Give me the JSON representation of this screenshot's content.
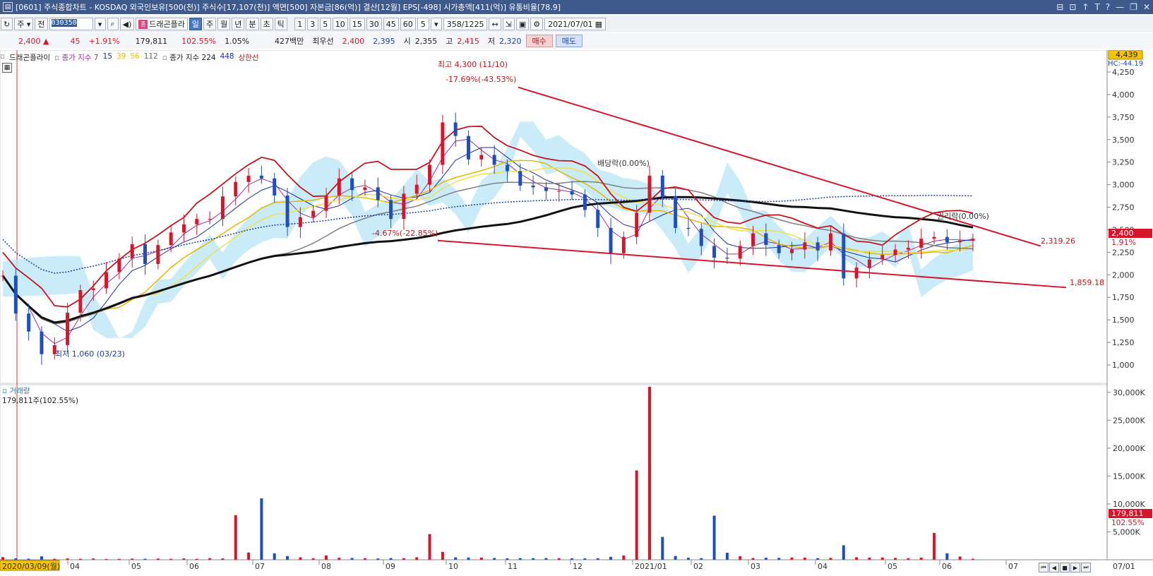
{
  "window": {
    "title": "[0601] 주식종합차트 - KOSDAQ 외국인보유[500(천)] 주식수[17,107(천)] 액면[500] 자본금[86(억)] 결산[12월] EPS[-498] 시가총액[411(억)] 유통비율[78.9]",
    "controls": [
      "⊟",
      "⊡",
      "↑",
      "T",
      "?",
      "—",
      "❐",
      "✕"
    ]
  },
  "toolbar": {
    "market": "주",
    "scope": "전",
    "code": "030350",
    "dragon_label": "드래곤플라",
    "periods": [
      "일",
      "주",
      "월",
      "년",
      "분",
      "초",
      "틱"
    ],
    "active_period": "일",
    "intervals": [
      "1",
      "3",
      "5",
      "10",
      "15",
      "30",
      "45",
      "60"
    ],
    "interval_value": "5",
    "count": "358",
    "total": "/1225",
    "date": "2021/07/01"
  },
  "quote": {
    "price": "2,400",
    "arrow": "▲",
    "change": "45",
    "change_pct": "+1.91%",
    "volume": "179,811",
    "volume_ratio": "102.55%",
    "turnover": "1.05%",
    "amount": "427백만",
    "best_label": "최우선",
    "ask": "2,400",
    "bid": "2,395",
    "open_label": "시",
    "open": "2,355",
    "high_label": "고",
    "high": "2,415",
    "low_label": "저",
    "low": "2,320",
    "buy": "매수",
    "sell": "매도"
  },
  "legend": {
    "dragon": "드래곤플라이",
    "ma_label": "종가 지수 7",
    "ma15": "15",
    "ma39": "39",
    "ma56": "56",
    "ma112": "112",
    "ma_label2": "종가 지수 224",
    "ma448": "448",
    "upper_line": "상한선"
  },
  "chart_data": {
    "type": "candlestick",
    "price_axis": {
      "ticks": [
        "4,250",
        "4,000",
        "3,750",
        "3,500",
        "3,250",
        "3,000",
        "2,750",
        "2,500",
        "2,250",
        "2,000",
        "1,750",
        "1,500",
        "1,250",
        "1,000"
      ],
      "ylim": [
        1000,
        4300
      ],
      "current_price_badge": "4,439",
      "hc_label": "HC:-44.19",
      "last_price": "2,400",
      "last_pct": "1.91%"
    },
    "volume_axis": {
      "ticks": [
        "30,000K",
        "25,000K",
        "20,000K",
        "15,000K",
        "10,000K",
        "5,000K"
      ],
      "last_volume": "179,811",
      "last_volume_pct": "102.55%",
      "title": "거래량",
      "value_line": "179,811주(102.55%)"
    },
    "x_axis": {
      "labels": [
        "2020/03/09(월)",
        "04",
        "05",
        "06",
        "07",
        "08",
        "09",
        "10",
        "11",
        "12",
        "2021/01",
        "02",
        "03",
        "04",
        "05",
        "06",
        "07"
      ],
      "end_label": "07/01"
    },
    "annotations": {
      "high": "최고 4,300 (11/10)",
      "high_pct": "-17.69%(-43.53%)",
      "low": "최저 1,060 (03/23)",
      "mid_low": "-4.67%(-22.85%)",
      "dividend1": "배당락(0.00%)",
      "dividend2": "권리락(0.00%)",
      "trend_upper": "2,319.26",
      "trend_lower": "1,859.18"
    },
    "closes": [
      1990,
      1570,
      1370,
      1120,
      1220,
      1580,
      1830,
      1850,
      2030,
      2180,
      2340,
      2120,
      2330,
      2470,
      2560,
      2620,
      2620,
      2870,
      3030,
      3100,
      3070,
      2880,
      2530,
      2640,
      2710,
      2880,
      3070,
      2940,
      2970,
      2830,
      2620,
      2900,
      3000,
      3220,
      3690,
      3540,
      3280,
      3330,
      3220,
      3150,
      2990,
      2970,
      2930,
      2930,
      2890,
      2720,
      2520,
      2240,
      2420,
      2690,
      3100,
      2870,
      2520,
      2510,
      2320,
      2190,
      2180,
      2320,
      2460,
      2330,
      2240,
      2280,
      2360,
      2270,
      2460,
      1960,
      2080,
      2170,
      2220,
      2280,
      2300,
      2400,
      2420,
      2360,
      2380,
      2400
    ],
    "volumes": [
      480,
      260,
      200,
      620,
      180,
      240,
      170,
      230,
      150,
      160,
      210,
      180,
      220,
      170,
      240,
      170,
      290,
      240,
      8000,
      1300,
      11000,
      1150,
      660,
      450,
      280,
      780,
      360,
      320,
      280,
      230,
      300,
      280,
      450,
      4600,
      1400,
      430,
      390,
      390,
      320,
      260,
      290,
      280,
      300,
      280,
      260,
      240,
      270,
      520,
      780,
      16000,
      31000,
      4100,
      680,
      360,
      290,
      7900,
      1250,
      640,
      310,
      360,
      340,
      400,
      380,
      290,
      340,
      2600,
      450,
      380,
      400,
      330,
      290,
      380,
      4800,
      1160,
      580,
      180
    ]
  }
}
